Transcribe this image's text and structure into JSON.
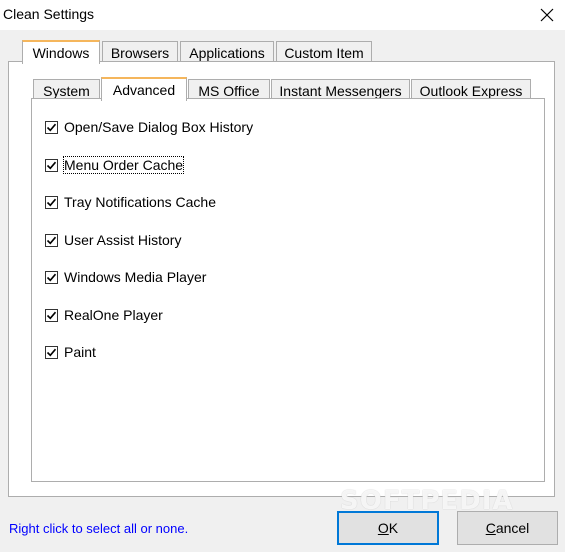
{
  "window": {
    "title": "Clean Settings"
  },
  "tabs": [
    {
      "label": "Windows",
      "selected": true
    },
    {
      "label": "Browsers",
      "selected": false
    },
    {
      "label": "Applications",
      "selected": false
    },
    {
      "label": "Custom Item",
      "selected": false
    }
  ],
  "subtabs": [
    {
      "label": "System",
      "selected": false
    },
    {
      "label": "Advanced",
      "selected": true
    },
    {
      "label": "MS Office",
      "selected": false
    },
    {
      "label": "Instant Messengers",
      "selected": false
    },
    {
      "label": "Outlook Express",
      "selected": false
    }
  ],
  "items": [
    {
      "label": "Open/Save Dialog Box History",
      "checked": true
    },
    {
      "label": "Menu Order Cache",
      "checked": true
    },
    {
      "label": "Tray Notifications Cache",
      "checked": true
    },
    {
      "label": "User Assist History",
      "checked": true
    },
    {
      "label": "Windows Media Player",
      "checked": true
    },
    {
      "label": "RealOne Player",
      "checked": true
    },
    {
      "label": "Paint",
      "checked": true
    }
  ],
  "footer": {
    "hint": "Right click to select all or none.",
    "ok_prefix": "",
    "ok_mnemonic": "O",
    "ok_rest": "K",
    "cancel_mnemonic": "C",
    "cancel_rest": "ancel"
  },
  "watermark": "SOFTPEDIA"
}
